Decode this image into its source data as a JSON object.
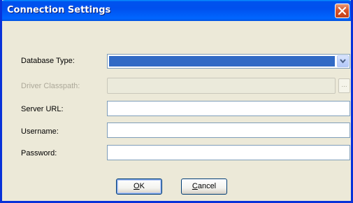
{
  "window": {
    "title": "Connection Settings"
  },
  "icons": {
    "close": "close-icon",
    "dropdown": "chevron-down-icon"
  },
  "colors": {
    "titlebar": "#0054e3",
    "close_button": "#d8542a",
    "selection": "#316ac5",
    "dialog_background": "#ece9d8",
    "disabled_text": "#aca899"
  },
  "form": {
    "database_type": {
      "label": "Database Type:",
      "value": ""
    },
    "driver_classpath": {
      "label": "Driver Classpath:",
      "value": "",
      "browse_label": "...",
      "enabled": false
    },
    "server_url": {
      "label": "Server URL:",
      "value": ""
    },
    "username": {
      "label": "Username:",
      "value": ""
    },
    "password": {
      "label": "Password:",
      "value": ""
    }
  },
  "buttons": {
    "ok": {
      "mnemonic": "O",
      "rest": "K"
    },
    "cancel": {
      "mnemonic": "C",
      "rest": "ancel"
    }
  }
}
